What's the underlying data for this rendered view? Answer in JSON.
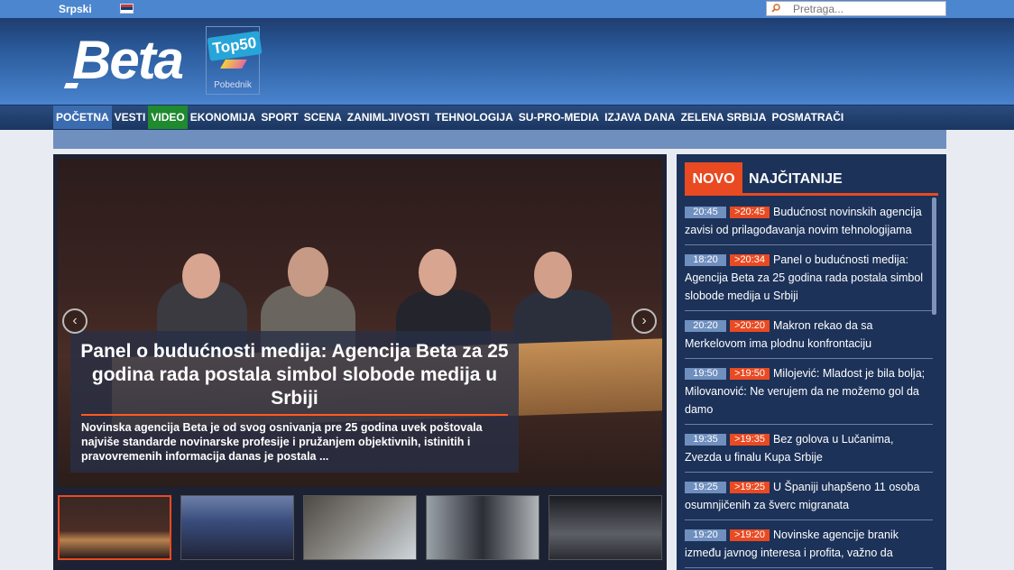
{
  "topbar": {
    "language": "Srpski",
    "flag_icon": "serbia-flag-icon",
    "search_placeholder": "Pretraga...",
    "search_icon": "magnifier-icon"
  },
  "header": {
    "logo_text": "Beta",
    "award": {
      "badge": "Top50",
      "label": "Pobednik"
    }
  },
  "nav": {
    "items": [
      "POČETNA",
      "VESTI",
      "VIDEO",
      "EKONOMIJA",
      "SPORT",
      "SCENA",
      "ZANIMLJIVOSTI",
      "TEHNOLOGIJA",
      "SU-PRO-MEDIA",
      "IZJAVA DANA",
      "ZELENA SRBIJA",
      "POSMATRAČI"
    ]
  },
  "slider": {
    "title": "Panel o budućnosti medija: Agencija Beta za 25 godina rada postala simbol slobode medija u Srbiji",
    "summary": "Novinska agencija Beta je od svog osnivanja pre 25 godina uvek poštovala najviše standarde novinarske profesije i pružanjem objektivnih, istinitih i pravovremenih informacija danas je postala ...",
    "prev_icon": "‹",
    "next_icon": "›"
  },
  "side": {
    "tab_new": "NOVO",
    "tab_most_read": "NAJČITANIJE",
    "news": [
      {
        "time": "20:45",
        "updated": ">20:45",
        "title": "Budućnost novinskih agencija zavisi od prilagođavanja novim tehnologijama"
      },
      {
        "time": "18:20",
        "updated": ">20:34",
        "title": "Panel o budućnosti medija: Agencija Beta za 25 godina rada postala simbol slobode medija u Srbiji"
      },
      {
        "time": "20:20",
        "updated": ">20:20",
        "title": "Makron rekao da sa Merkelovom ima plodnu konfrontaciju"
      },
      {
        "time": "19:50",
        "updated": ">19:50",
        "title": "Milojević: Mladost je bila bolja; Milovanović: Ne verujem da ne možemo gol da damo"
      },
      {
        "time": "19:35",
        "updated": ">19:35",
        "title": "Bez golova u Lučanima, Zvezda u finalu Kupa Srbije"
      },
      {
        "time": "19:25",
        "updated": ">19:25",
        "title": "U Španiji uhapšeno 11 osoba osumnjičenih za šverc migranata"
      },
      {
        "time": "19:20",
        "updated": ">19:20",
        "title": "Novinske agencije branik između javnog interesa i profita, važno da"
      }
    ]
  }
}
